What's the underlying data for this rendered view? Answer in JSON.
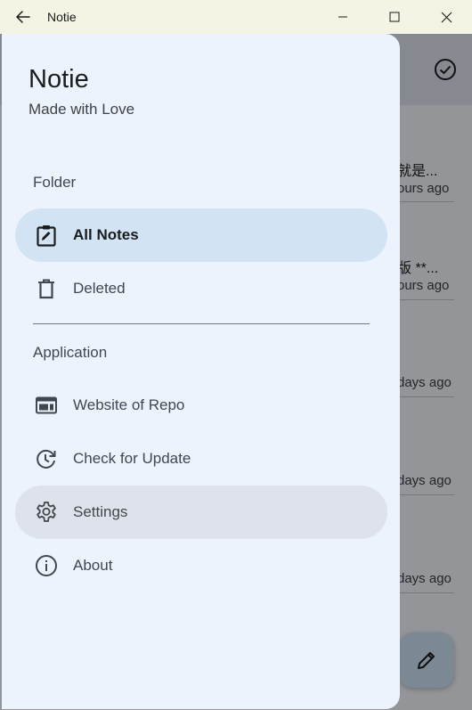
{
  "window": {
    "title": "Notie"
  },
  "background_app": {
    "notes": [
      {
        "snippet": "就是...",
        "time": "ours ago"
      },
      {
        "snippet": "版 **...",
        "time": "ours ago"
      },
      {
        "snippet": "",
        "time": "days ago"
      },
      {
        "snippet": "",
        "time": "days ago"
      },
      {
        "snippet": "",
        "time": "days ago"
      }
    ]
  },
  "drawer": {
    "app_name": "Notie",
    "tagline": "Made with Love",
    "folder_section": "Folder",
    "folder_items": [
      {
        "label": "All Notes",
        "icon": "clipboard-edit-icon",
        "active": true
      },
      {
        "label": "Deleted",
        "icon": "trash-icon",
        "active": false
      }
    ],
    "application_section": "Application",
    "application_items": [
      {
        "label": "Website of Repo",
        "icon": "web-icon"
      },
      {
        "label": "Check for Update",
        "icon": "update-icon"
      },
      {
        "label": "Settings",
        "icon": "gear-icon",
        "highlighted": true
      },
      {
        "label": "About",
        "icon": "info-icon"
      }
    ]
  },
  "colors": {
    "drawer_bg": "#ecf3fc",
    "active_item_bg": "#d2e4f4",
    "hover_item_bg": "#dee2ea",
    "titlebar_bg": "#f3f4e4"
  }
}
